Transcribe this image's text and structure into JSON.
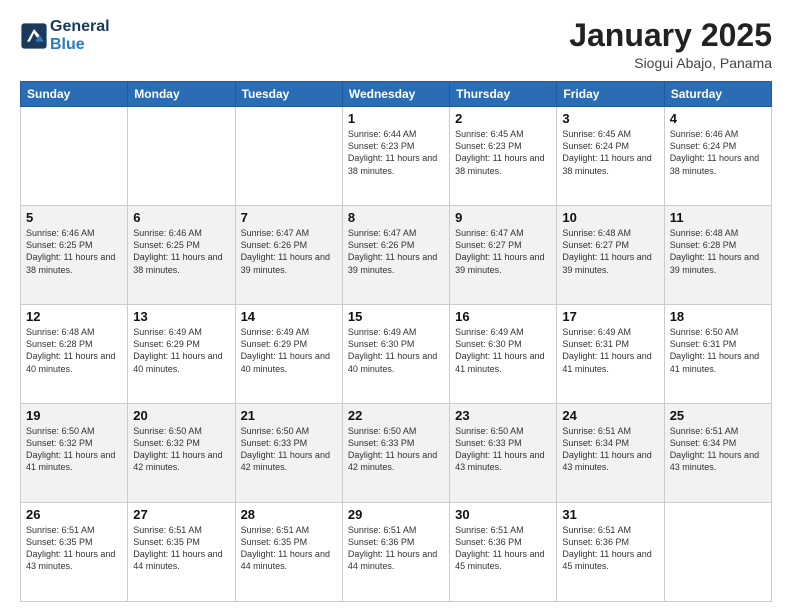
{
  "header": {
    "logo_line1": "General",
    "logo_line2": "Blue",
    "month": "January 2025",
    "location": "Siogui Abajo, Panama"
  },
  "days_of_week": [
    "Sunday",
    "Monday",
    "Tuesday",
    "Wednesday",
    "Thursday",
    "Friday",
    "Saturday"
  ],
  "weeks": [
    [
      {
        "day": "",
        "sunrise": "",
        "sunset": "",
        "daylight": ""
      },
      {
        "day": "",
        "sunrise": "",
        "sunset": "",
        "daylight": ""
      },
      {
        "day": "",
        "sunrise": "",
        "sunset": "",
        "daylight": ""
      },
      {
        "day": "1",
        "sunrise": "Sunrise: 6:44 AM",
        "sunset": "Sunset: 6:23 PM",
        "daylight": "Daylight: 11 hours and 38 minutes."
      },
      {
        "day": "2",
        "sunrise": "Sunrise: 6:45 AM",
        "sunset": "Sunset: 6:23 PM",
        "daylight": "Daylight: 11 hours and 38 minutes."
      },
      {
        "day": "3",
        "sunrise": "Sunrise: 6:45 AM",
        "sunset": "Sunset: 6:24 PM",
        "daylight": "Daylight: 11 hours and 38 minutes."
      },
      {
        "day": "4",
        "sunrise": "Sunrise: 6:46 AM",
        "sunset": "Sunset: 6:24 PM",
        "daylight": "Daylight: 11 hours and 38 minutes."
      }
    ],
    [
      {
        "day": "5",
        "sunrise": "Sunrise: 6:46 AM",
        "sunset": "Sunset: 6:25 PM",
        "daylight": "Daylight: 11 hours and 38 minutes."
      },
      {
        "day": "6",
        "sunrise": "Sunrise: 6:46 AM",
        "sunset": "Sunset: 6:25 PM",
        "daylight": "Daylight: 11 hours and 38 minutes."
      },
      {
        "day": "7",
        "sunrise": "Sunrise: 6:47 AM",
        "sunset": "Sunset: 6:26 PM",
        "daylight": "Daylight: 11 hours and 39 minutes."
      },
      {
        "day": "8",
        "sunrise": "Sunrise: 6:47 AM",
        "sunset": "Sunset: 6:26 PM",
        "daylight": "Daylight: 11 hours and 39 minutes."
      },
      {
        "day": "9",
        "sunrise": "Sunrise: 6:47 AM",
        "sunset": "Sunset: 6:27 PM",
        "daylight": "Daylight: 11 hours and 39 minutes."
      },
      {
        "day": "10",
        "sunrise": "Sunrise: 6:48 AM",
        "sunset": "Sunset: 6:27 PM",
        "daylight": "Daylight: 11 hours and 39 minutes."
      },
      {
        "day": "11",
        "sunrise": "Sunrise: 6:48 AM",
        "sunset": "Sunset: 6:28 PM",
        "daylight": "Daylight: 11 hours and 39 minutes."
      }
    ],
    [
      {
        "day": "12",
        "sunrise": "Sunrise: 6:48 AM",
        "sunset": "Sunset: 6:28 PM",
        "daylight": "Daylight: 11 hours and 40 minutes."
      },
      {
        "day": "13",
        "sunrise": "Sunrise: 6:49 AM",
        "sunset": "Sunset: 6:29 PM",
        "daylight": "Daylight: 11 hours and 40 minutes."
      },
      {
        "day": "14",
        "sunrise": "Sunrise: 6:49 AM",
        "sunset": "Sunset: 6:29 PM",
        "daylight": "Daylight: 11 hours and 40 minutes."
      },
      {
        "day": "15",
        "sunrise": "Sunrise: 6:49 AM",
        "sunset": "Sunset: 6:30 PM",
        "daylight": "Daylight: 11 hours and 40 minutes."
      },
      {
        "day": "16",
        "sunrise": "Sunrise: 6:49 AM",
        "sunset": "Sunset: 6:30 PM",
        "daylight": "Daylight: 11 hours and 41 minutes."
      },
      {
        "day": "17",
        "sunrise": "Sunrise: 6:49 AM",
        "sunset": "Sunset: 6:31 PM",
        "daylight": "Daylight: 11 hours and 41 minutes."
      },
      {
        "day": "18",
        "sunrise": "Sunrise: 6:50 AM",
        "sunset": "Sunset: 6:31 PM",
        "daylight": "Daylight: 11 hours and 41 minutes."
      }
    ],
    [
      {
        "day": "19",
        "sunrise": "Sunrise: 6:50 AM",
        "sunset": "Sunset: 6:32 PM",
        "daylight": "Daylight: 11 hours and 41 minutes."
      },
      {
        "day": "20",
        "sunrise": "Sunrise: 6:50 AM",
        "sunset": "Sunset: 6:32 PM",
        "daylight": "Daylight: 11 hours and 42 minutes."
      },
      {
        "day": "21",
        "sunrise": "Sunrise: 6:50 AM",
        "sunset": "Sunset: 6:33 PM",
        "daylight": "Daylight: 11 hours and 42 minutes."
      },
      {
        "day": "22",
        "sunrise": "Sunrise: 6:50 AM",
        "sunset": "Sunset: 6:33 PM",
        "daylight": "Daylight: 11 hours and 42 minutes."
      },
      {
        "day": "23",
        "sunrise": "Sunrise: 6:50 AM",
        "sunset": "Sunset: 6:33 PM",
        "daylight": "Daylight: 11 hours and 43 minutes."
      },
      {
        "day": "24",
        "sunrise": "Sunrise: 6:51 AM",
        "sunset": "Sunset: 6:34 PM",
        "daylight": "Daylight: 11 hours and 43 minutes."
      },
      {
        "day": "25",
        "sunrise": "Sunrise: 6:51 AM",
        "sunset": "Sunset: 6:34 PM",
        "daylight": "Daylight: 11 hours and 43 minutes."
      }
    ],
    [
      {
        "day": "26",
        "sunrise": "Sunrise: 6:51 AM",
        "sunset": "Sunset: 6:35 PM",
        "daylight": "Daylight: 11 hours and 43 minutes."
      },
      {
        "day": "27",
        "sunrise": "Sunrise: 6:51 AM",
        "sunset": "Sunset: 6:35 PM",
        "daylight": "Daylight: 11 hours and 44 minutes."
      },
      {
        "day": "28",
        "sunrise": "Sunrise: 6:51 AM",
        "sunset": "Sunset: 6:35 PM",
        "daylight": "Daylight: 11 hours and 44 minutes."
      },
      {
        "day": "29",
        "sunrise": "Sunrise: 6:51 AM",
        "sunset": "Sunset: 6:36 PM",
        "daylight": "Daylight: 11 hours and 44 minutes."
      },
      {
        "day": "30",
        "sunrise": "Sunrise: 6:51 AM",
        "sunset": "Sunset: 6:36 PM",
        "daylight": "Daylight: 11 hours and 45 minutes."
      },
      {
        "day": "31",
        "sunrise": "Sunrise: 6:51 AM",
        "sunset": "Sunset: 6:36 PM",
        "daylight": "Daylight: 11 hours and 45 minutes."
      },
      {
        "day": "",
        "sunrise": "",
        "sunset": "",
        "daylight": ""
      }
    ]
  ]
}
